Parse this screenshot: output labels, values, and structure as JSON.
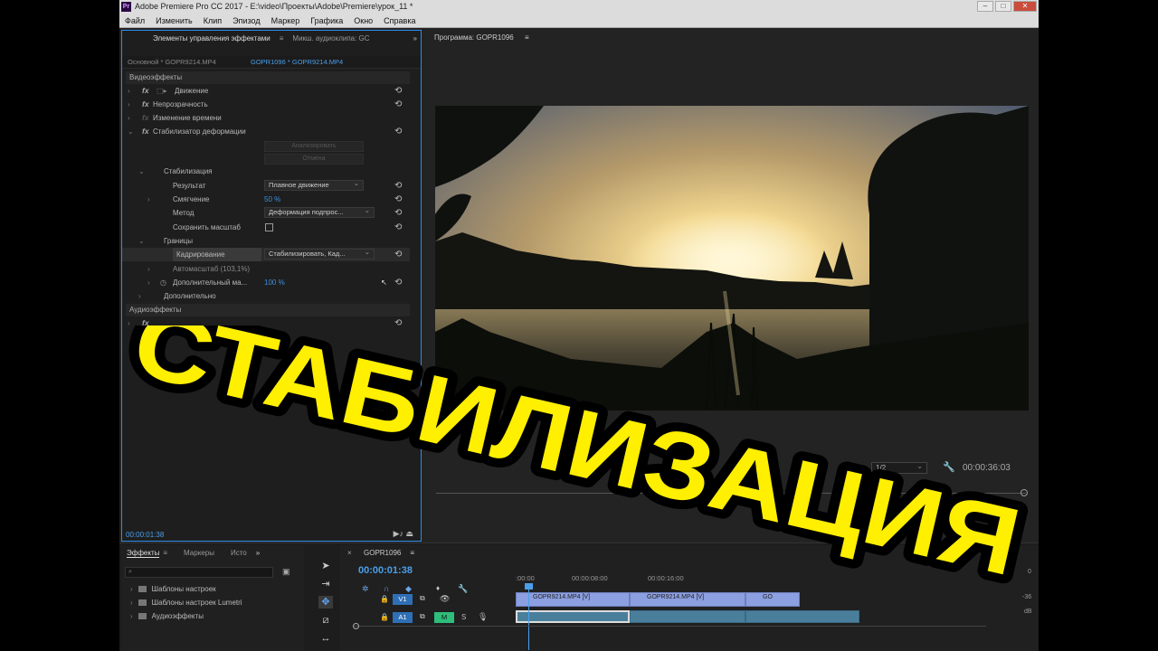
{
  "window": {
    "logo": "Pr",
    "title": "Adobe Premiere Pro CC 2017 - E:\\video\\Проекты\\Adobe\\Premiere\\урок_11 *",
    "min": "–",
    "max": "□",
    "close": "✕"
  },
  "menu": [
    "Файл",
    "Изменить",
    "Клип",
    "Эпизод",
    "Маркер",
    "Графика",
    "Окно",
    "Справка"
  ],
  "effect_controls": {
    "tab_active": "Элементы управления эффектами",
    "tab_menu": "≡",
    "tab_other": "Микш. аудиоклипа: GC",
    "overflow": "»",
    "source_clip": "Основной * GOPR9214.MP4",
    "active_clip": "GOPR1096 * GOPR9214.MP4",
    "video_effects_header": "Видеоэффекты",
    "audio_effects_header": "Аудиоэффекты",
    "motion": "Движение",
    "opacity": "Непрозрачность",
    "time_remap": "Изменение времени",
    "warp_stabilizer": "Стабилизатор деформации",
    "analyze_btn": "Анализировать",
    "cancel_btn": "Отмена",
    "stabilization": "Стабилизация",
    "result_label": "Результат",
    "result_value": "Плавное движение",
    "smoothness_label": "Смягчение",
    "smoothness_value": "50 %",
    "method_label": "Метод",
    "method_value": "Деформация подпрос...",
    "preserve_scale_label": "Сохранить масштаб",
    "borders": "Границы",
    "framing_label": "Кадрирование",
    "framing_value": "Стабилизировать, Кад...",
    "autoscale_label": "Автомасштаб (103,1%)",
    "add_scale_label": "Дополнительный ма...",
    "add_scale_value": "100 %",
    "advanced": "Дополнительно",
    "audio_row2": "...ания",
    "fx": "fx",
    "reset": "⟲",
    "timecode": "00:00:01:38",
    "bottom_icons": "▶♪ ⏏"
  },
  "program": {
    "title": "Программа: GOPR1096",
    "menu": "≡",
    "zoom": "1/2",
    "wrench": "🔧",
    "timecode": "00:00:36:03",
    "add": "+"
  },
  "project": {
    "tab_effects": "Эффекты",
    "tab_menu": "≡",
    "tab_markers": "Маркеры",
    "tab_history": "Исто",
    "overflow": "»",
    "search_icon": "⌕",
    "new_bin": "▣",
    "items": [
      "Шаблоны настроек",
      "Шаблоны настроек Lumetri",
      "Аудиоэффекты"
    ]
  },
  "tools": [
    "➤",
    "⇥",
    "✥",
    "⧄",
    "↔"
  ],
  "timeline": {
    "close": "×",
    "sequence": "GOPR1096",
    "menu": "≡",
    "timecode": "00:00:01:38",
    "ruler": [
      ":00:00",
      "00:00:08:00",
      "00:00:16:00"
    ],
    "track_v1": "V1",
    "track_a1": "A1",
    "mute": "M",
    "solo": "S",
    "clip1": "GOPR9214.MP4 [V]",
    "clip2": "GOPR9214.MP4 [V]",
    "clip3": "GO",
    "meter": [
      "0",
      "-36",
      "dB"
    ]
  },
  "overlay": {
    "caption": "СТАБИЛИЗАЦИЯ",
    "caption_color": "#ffef00"
  },
  "colors": {
    "accent": "#2d8ceb",
    "timecode": "#4a9fea",
    "video_clip": "#8c9fe0",
    "audio_clip": "#4a7f9c",
    "v1_label": "#2f6fb5",
    "mute_btn": "#2ebd7a"
  }
}
